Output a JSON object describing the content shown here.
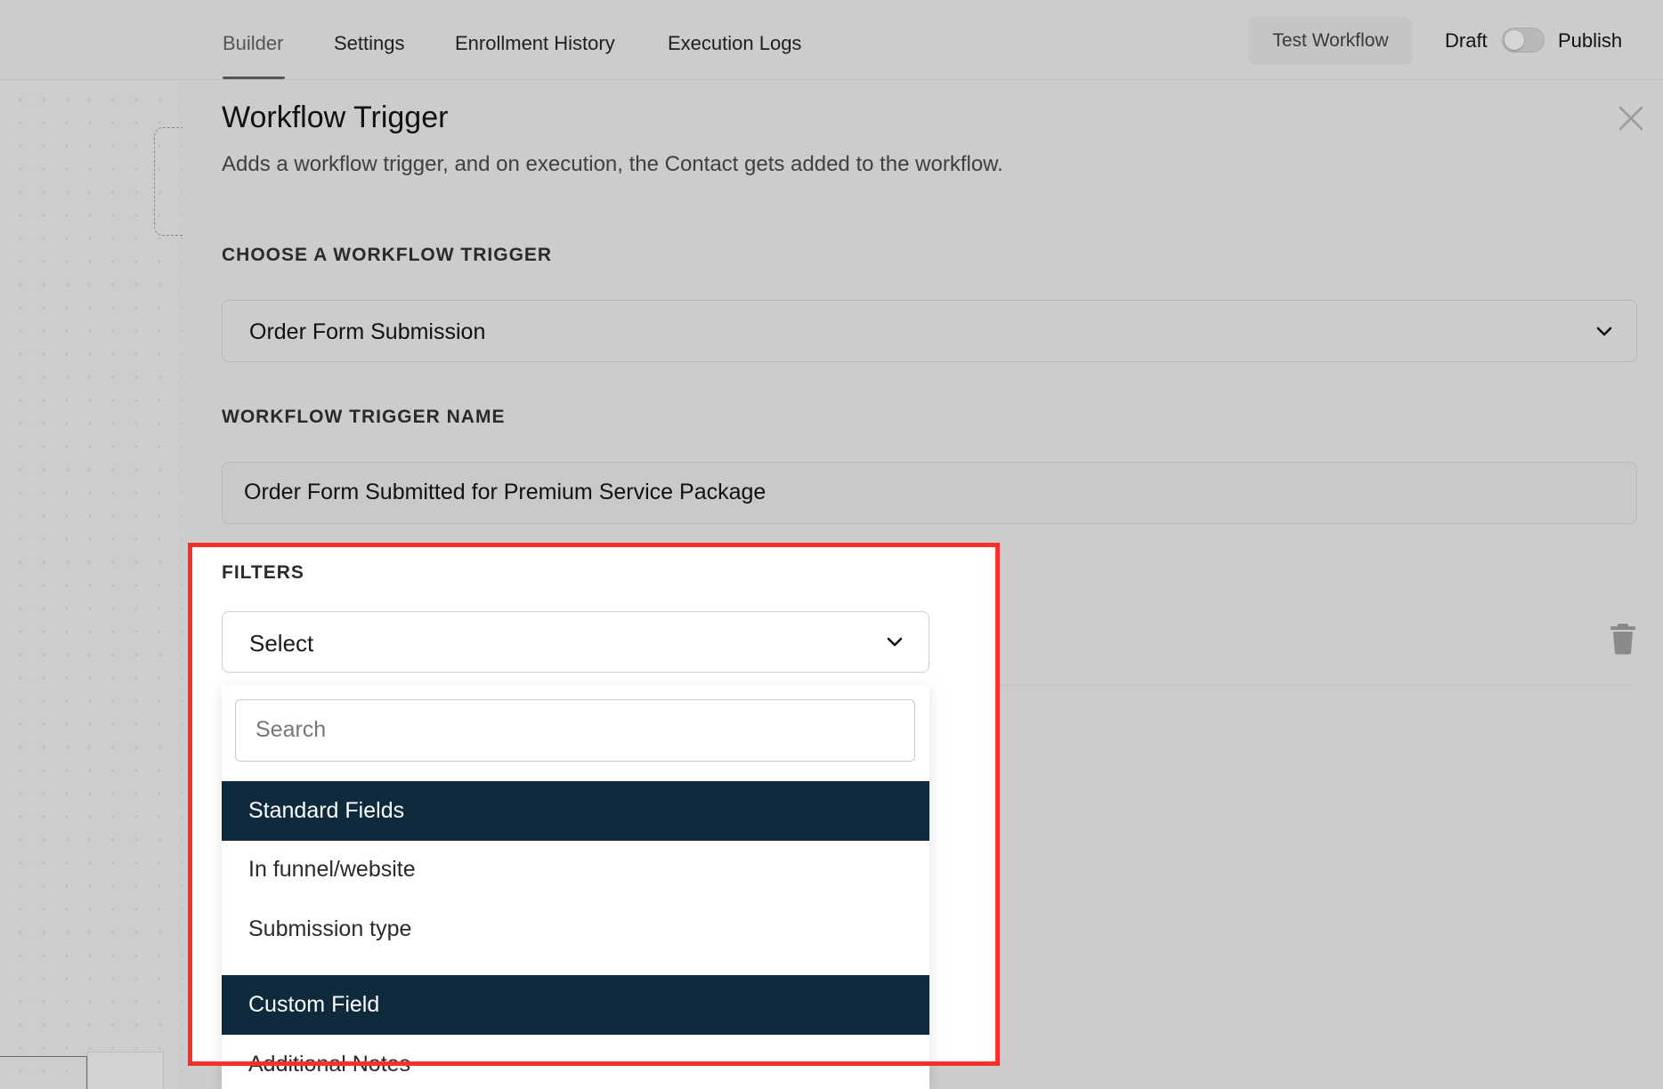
{
  "nav": {
    "tabs": [
      {
        "label": "Builder",
        "active": true
      },
      {
        "label": "Settings",
        "active": false
      },
      {
        "label": "Enrollment History",
        "active": false
      },
      {
        "label": "Execution Logs",
        "active": false
      }
    ],
    "test_button": "Test Workflow",
    "draft_label": "Draft",
    "publish_label": "Publish",
    "publish_toggle_on": false
  },
  "drawer": {
    "title": "Workflow Trigger",
    "subtitle": "Adds a workflow trigger, and on execution, the Contact gets added to the workflow.",
    "trigger_section_label": "CHOOSE A WORKFLOW TRIGGER",
    "trigger_selected": "Order Form Submission",
    "name_section_label": "WORKFLOW TRIGGER NAME",
    "trigger_name_value": "Order Form Submitted for Premium Service Package",
    "filters_label": "FILTERS",
    "filter_select_value": "Select",
    "dropdown": {
      "search_placeholder": "Search",
      "groups": [
        {
          "label": "Standard Fields",
          "items": [
            "In funnel/website",
            "Submission type"
          ]
        },
        {
          "label": "Custom Field",
          "items": [
            "Additional Notes"
          ]
        }
      ]
    }
  },
  "colors": {
    "group_header_bg": "#0f2a3d",
    "highlight_border": "#f4322b"
  },
  "icons": {
    "close": "close-icon",
    "chevron": "chevron-down-icon",
    "delete": "trash-icon"
  }
}
